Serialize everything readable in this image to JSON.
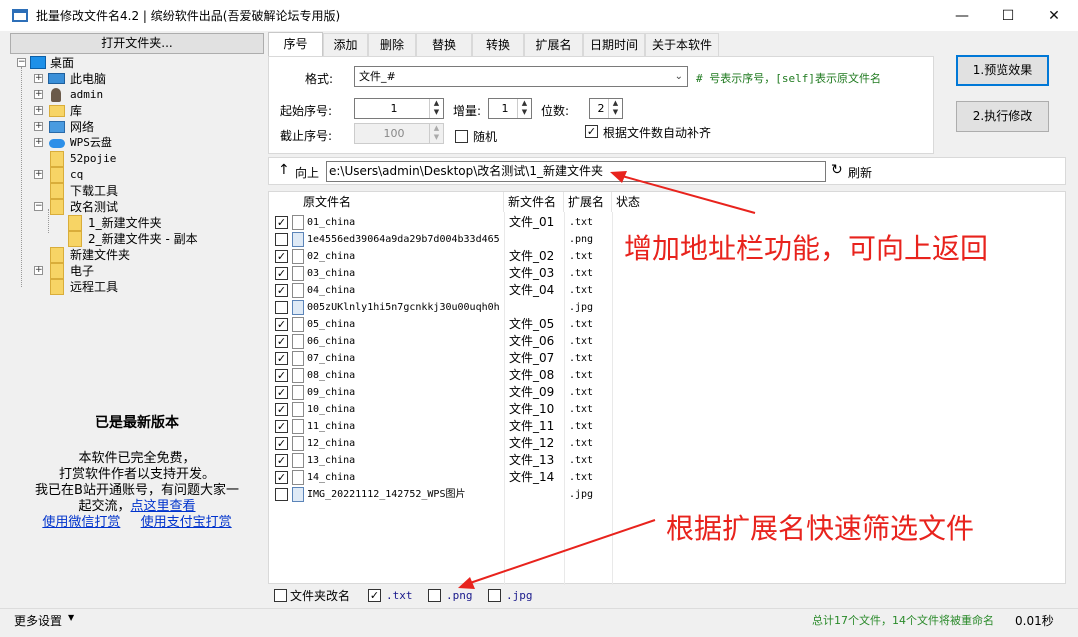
{
  "window": {
    "title": "批量修改文件名4.2 | 缤纷软件出品(吾爱破解论坛专用版)",
    "minimize": "—",
    "maximize": "☐",
    "close": "✕"
  },
  "left": {
    "open_folder_label": "打开文件夹...",
    "tree": [
      {
        "label": "桌面",
        "icon": "desktop-icon"
      },
      {
        "label": "此电脑",
        "icon": "computer-icon"
      },
      {
        "label": "admin",
        "icon": "user-icon"
      },
      {
        "label": "库",
        "icon": "library-icon"
      },
      {
        "label": "网络",
        "icon": "network-icon"
      },
      {
        "label": "WPS云盘",
        "icon": "cloud-icon"
      },
      {
        "label": "52pojie",
        "icon": "folder-icon"
      },
      {
        "label": "cq",
        "icon": "folder-icon"
      },
      {
        "label": "下载工具",
        "icon": "folder-icon"
      },
      {
        "label": "改名测试",
        "icon": "folder-icon"
      },
      {
        "label": "1_新建文件夹",
        "icon": "folder-icon"
      },
      {
        "label": "2_新建文件夹 - 副本",
        "icon": "folder-icon"
      },
      {
        "label": "新建文件夹",
        "icon": "folder-icon"
      },
      {
        "label": "电子",
        "icon": "folder-icon"
      },
      {
        "label": "远程工具",
        "icon": "folder-icon"
      }
    ],
    "version_title": "已是最新版本",
    "info_line1": "本软件已完全免费，",
    "info_line2": "打赏软件作者以支持开发。",
    "info_line3": "我已在B站开通账号，有问题大家一",
    "info_line4a": "起交流，",
    "info_link_view": "点这里查看",
    "link_wechat": "使用微信打赏",
    "link_alipay": "使用支付宝打赏"
  },
  "tabs": [
    "序号",
    "添加",
    "删除",
    "替换",
    "转换",
    "扩展名",
    "日期时间",
    "关于本软件"
  ],
  "seq": {
    "format_label": "格式:",
    "format_value": "文件_#",
    "format_hint": "# 号表示序号，[self]表示原文件名",
    "start_label": "起始序号:",
    "start_value": "1",
    "step_label": "增量:",
    "step_value": "1",
    "digits_label": "位数:",
    "digits_value": "2",
    "end_label": "截止序号:",
    "end_value": "100",
    "random_label": "随机",
    "auto_pad_label": "根据文件数自动补齐"
  },
  "actions": {
    "preview": "1.预览效果",
    "execute": "2.执行修改"
  },
  "address": {
    "up_label": "向上",
    "path": "e:\\Users\\admin\\Desktop\\改名测试\\1_新建文件夹",
    "refresh_label": "刷新"
  },
  "table": {
    "headers": [
      "原文件名",
      "新文件名",
      "扩展名",
      "状态"
    ],
    "rows": [
      {
        "checked": true,
        "type": "doc",
        "orig": "01_china",
        "new": "文件_01",
        "ext": ".txt"
      },
      {
        "checked": false,
        "type": "img",
        "orig": "1e4556ed39064a9da29b7d004b33d465",
        "new": "",
        "ext": ".png"
      },
      {
        "checked": true,
        "type": "doc",
        "orig": "02_china",
        "new": "文件_02",
        "ext": ".txt"
      },
      {
        "checked": true,
        "type": "doc",
        "orig": "03_china",
        "new": "文件_03",
        "ext": ".txt"
      },
      {
        "checked": true,
        "type": "doc",
        "orig": "04_china",
        "new": "文件_04",
        "ext": ".txt"
      },
      {
        "checked": false,
        "type": "img",
        "orig": "005zUKlnly1hi5n7gcnkkj30u00uqh0h",
        "new": "",
        "ext": ".jpg"
      },
      {
        "checked": true,
        "type": "doc",
        "orig": "05_china",
        "new": "文件_05",
        "ext": ".txt"
      },
      {
        "checked": true,
        "type": "doc",
        "orig": "06_china",
        "new": "文件_06",
        "ext": ".txt"
      },
      {
        "checked": true,
        "type": "doc",
        "orig": "07_china",
        "new": "文件_07",
        "ext": ".txt"
      },
      {
        "checked": true,
        "type": "doc",
        "orig": "08_china",
        "new": "文件_08",
        "ext": ".txt"
      },
      {
        "checked": true,
        "type": "doc",
        "orig": "09_china",
        "new": "文件_09",
        "ext": ".txt"
      },
      {
        "checked": true,
        "type": "doc",
        "orig": "10_china",
        "new": "文件_10",
        "ext": ".txt"
      },
      {
        "checked": true,
        "type": "doc",
        "orig": "11_china",
        "new": "文件_11",
        "ext": ".txt"
      },
      {
        "checked": true,
        "type": "doc",
        "orig": "12_china",
        "new": "文件_12",
        "ext": ".txt"
      },
      {
        "checked": true,
        "type": "doc",
        "orig": "13_china",
        "new": "文件_13",
        "ext": ".txt"
      },
      {
        "checked": true,
        "type": "doc",
        "orig": "14_china",
        "new": "文件_14",
        "ext": ".txt"
      },
      {
        "checked": false,
        "type": "img",
        "orig": "IMG_20221112_142752_WPS图片",
        "new": "",
        "ext": ".jpg"
      }
    ]
  },
  "annotations": {
    "address_bar": "增加地址栏功能，可向上返回",
    "filter": "根据扩展名快速筛选文件"
  },
  "filter": {
    "folder_rename_label": "文件夹改名",
    "ext_txt": ".txt",
    "ext_png": ".png",
    "ext_jpg": ".jpg"
  },
  "status": {
    "more_settings": "更多设置",
    "summary": "总计17个文件，14个文件将被重命名",
    "time": "0.01秒"
  },
  "colors": {
    "accent": "#0078d7",
    "annotation": "#e8231d",
    "hint_green": "#1f7a1f",
    "status_green": "#2a8a2a"
  }
}
